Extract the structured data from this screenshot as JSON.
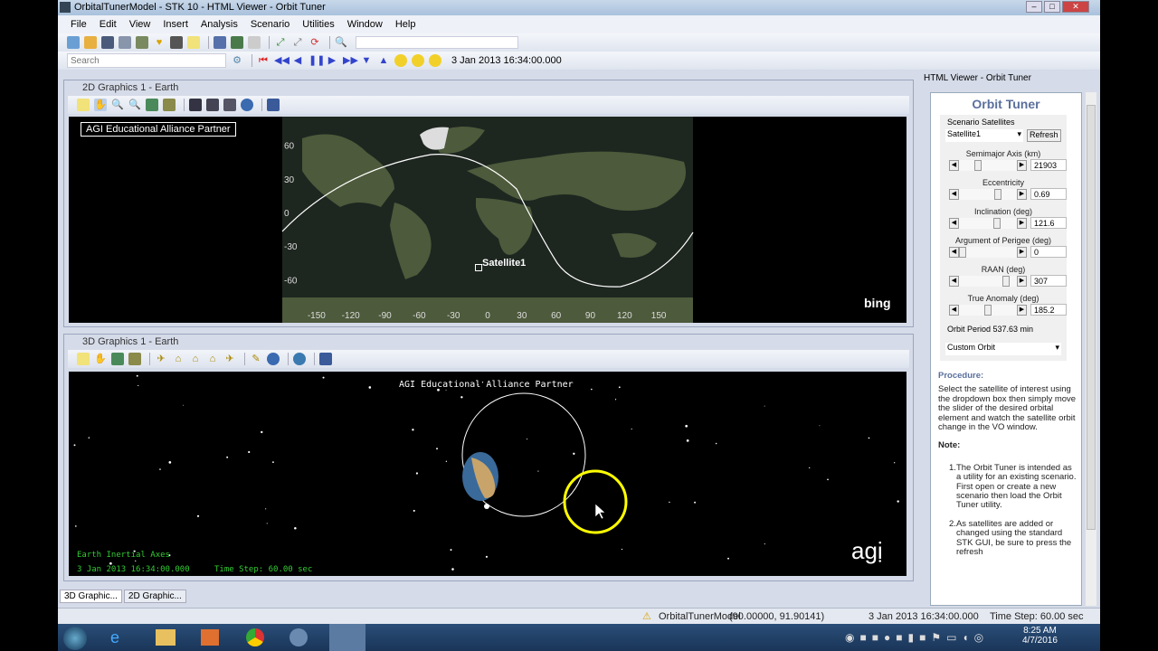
{
  "window": {
    "title": "OrbitalTunerModel - STK 10 - HTML Viewer - Orbit Tuner",
    "min": "–",
    "max": "□",
    "close": "✕"
  },
  "menu": [
    "File",
    "Edit",
    "View",
    "Insert",
    "Analysis",
    "Scenario",
    "Utilities",
    "Window",
    "Help"
  ],
  "toolbar": {
    "search_placeholder": "Search",
    "time": "3 Jan 2013 16:34:00.000"
  },
  "graphics2d": {
    "title": "2D Graphics 1 - Earth",
    "watermark": "AGI Educational Alliance Partner",
    "satellite": "Satellite1",
    "bing": "bing",
    "lat_ticks": [
      "60",
      "30",
      "0",
      "-30",
      "-60"
    ],
    "lon_ticks": [
      "-150",
      "-120",
      "-90",
      "-60",
      "-30",
      "0",
      "30",
      "60",
      "90",
      "120",
      "150"
    ]
  },
  "graphics3d": {
    "title": "3D Graphics 1 - Earth",
    "watermark": "AGI Educational Alliance Partner",
    "axes": "Earth Inertial Axes",
    "time": "3 Jan 2013 16:34:00.000",
    "timestep": "Time Step: 60.00 sec",
    "logo": "agi"
  },
  "htmlviewer": {
    "title": "HTML Viewer - Orbit Tuner",
    "heading": "Orbit Tuner",
    "scenario_label": "Scenario Satellites",
    "satellite": "Satellite1",
    "refresh": "Refresh",
    "params": [
      {
        "label": "Semimajor Axis (km)",
        "value": "21903",
        "pos": 0.3
      },
      {
        "label": "Eccentricity",
        "value": "0.69",
        "pos": 0.69
      },
      {
        "label": "Inclination (deg)",
        "value": "121.6",
        "pos": 0.68
      },
      {
        "label": "Argument of Perigee (deg)",
        "value": "0",
        "pos": 0
      },
      {
        "label": "RAAN (deg)",
        "value": "307",
        "pos": 0.85
      },
      {
        "label": "True Anomaly (deg)",
        "value": "185.2",
        "pos": 0.5
      }
    ],
    "period": "Orbit Period  537.63 min",
    "orbit_type": "Custom Orbit",
    "procedure_h": "Procedure:",
    "procedure": "Select the satellite of interest using the dropdown box then simply move the slider of the desired orbital element and watch the satellite orbit change in the VO window.",
    "note_h": "Note:",
    "notes": [
      "The Orbit Tuner is intended as a utility for an existing scenario. First open or create a new scenario then load the Orbit Tuner utility.",
      "As satellites are added or changed using the standard STK GUI, be sure to press the refresh"
    ]
  },
  "tabs": [
    "3D Graphic...",
    "2D Graphic..."
  ],
  "status": {
    "scenario": "OrbitalTunerModel",
    "coords": "(90.00000, 91.90141)",
    "time": "3 Jan 2013 16:34:00.000",
    "timestep": "Time Step: 60.00 sec"
  },
  "taskbar": {
    "time": "8:25 AM",
    "date": "4/7/2016"
  },
  "colors": {
    "accent": "#5a6f9c",
    "highlight": "#ffff00",
    "procedure": "#5a6f9c"
  }
}
